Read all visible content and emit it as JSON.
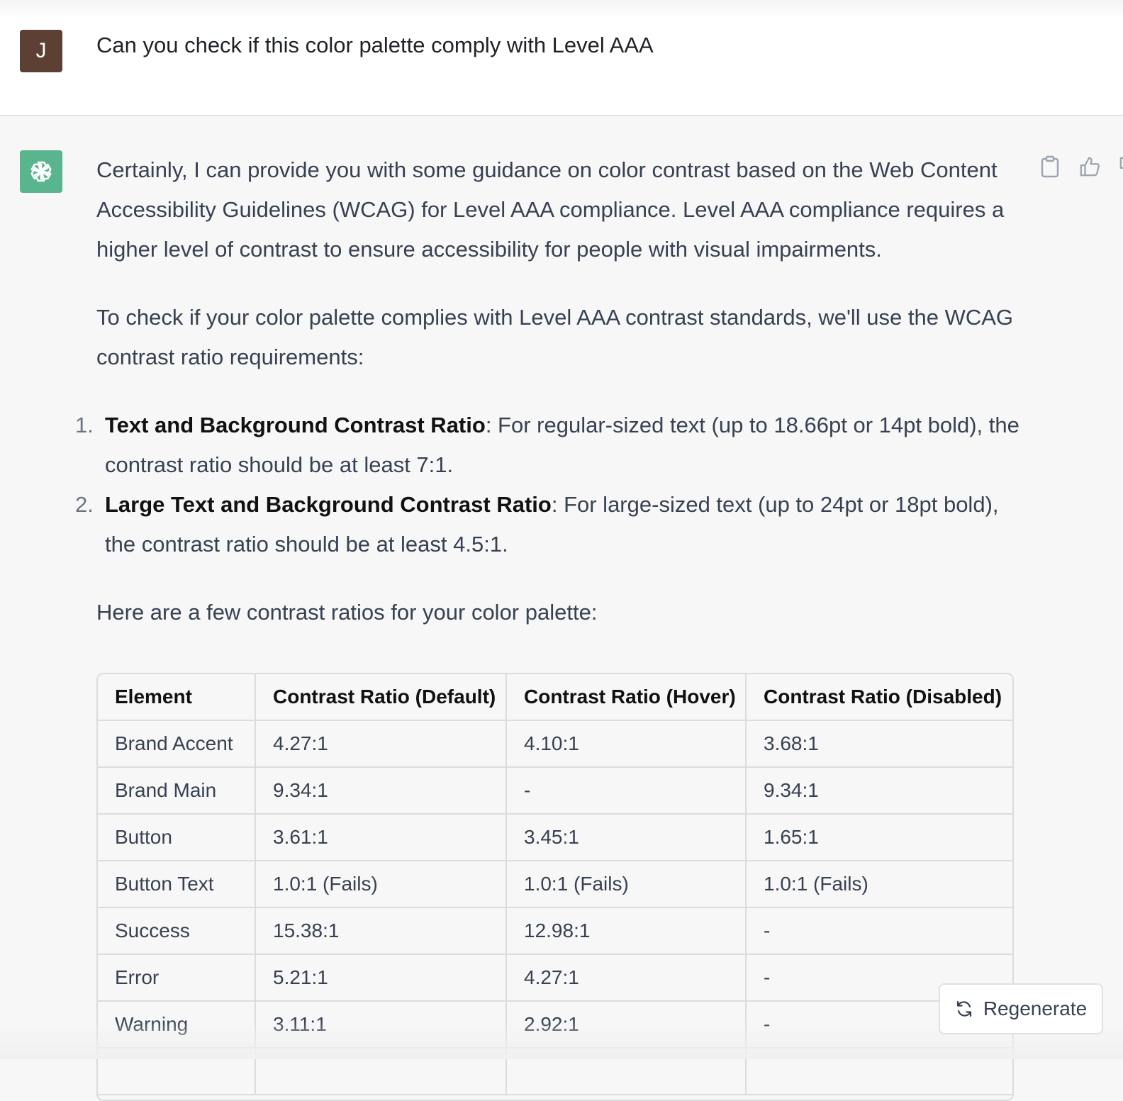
{
  "user": {
    "avatar_letter": "J",
    "message": "Can you check if this color palette comply with Level AAA"
  },
  "assistant": {
    "para1": "Certainly, I can provide you with some guidance on color contrast based on the Web Content Accessibility Guidelines (WCAG) for Level AAA compliance. Level AAA compliance requires a higher level of contrast to ensure accessibility for people with visual impairments.",
    "para2": "To check if your color palette complies with Level AAA contrast standards, we'll use the WCAG contrast ratio requirements:",
    "list": [
      {
        "num": "1.",
        "bold": "Text and Background Contrast Ratio",
        "text": ": For regular-sized text (up to 18.66pt or 14pt bold), the contrast ratio should be at least 7:1."
      },
      {
        "num": "2.",
        "bold": "Large Text and Background Contrast Ratio",
        "text": ": For large-sized text (up to 24pt or 18pt bold), the contrast ratio should be at least 4.5:1."
      }
    ],
    "para3": "Here are a few contrast ratios for your color palette:"
  },
  "table": {
    "headers": [
      "Element",
      "Contrast Ratio (Default)",
      "Contrast Ratio (Hover)",
      "Contrast Ratio (Disabled)"
    ],
    "rows": [
      [
        "Brand Accent",
        "4.27:1",
        "4.10:1",
        "3.68:1"
      ],
      [
        "Brand Main",
        "9.34:1",
        "-",
        "9.34:1"
      ],
      [
        "Button",
        "3.61:1",
        "3.45:1",
        "1.65:1"
      ],
      [
        "Button Text",
        "1.0:1 (Fails)",
        "1.0:1 (Fails)",
        "1.0:1 (Fails)"
      ],
      [
        "Success",
        "15.38:1",
        "12.98:1",
        "-"
      ],
      [
        "Error",
        "5.21:1",
        "4.27:1",
        "-"
      ],
      [
        "Warning",
        "3.11:1",
        "2.92:1",
        "-"
      ]
    ]
  },
  "regenerate_label": "Regenerate",
  "colors": {
    "user_avatar": "#5c4033",
    "bot_avatar": "#58b58e",
    "bot_bg": "#f7f7f8"
  },
  "icons": [
    "openai-logo-icon",
    "clipboard-icon",
    "thumbs-up-icon",
    "thumbs-down-icon",
    "refresh-icon"
  ]
}
